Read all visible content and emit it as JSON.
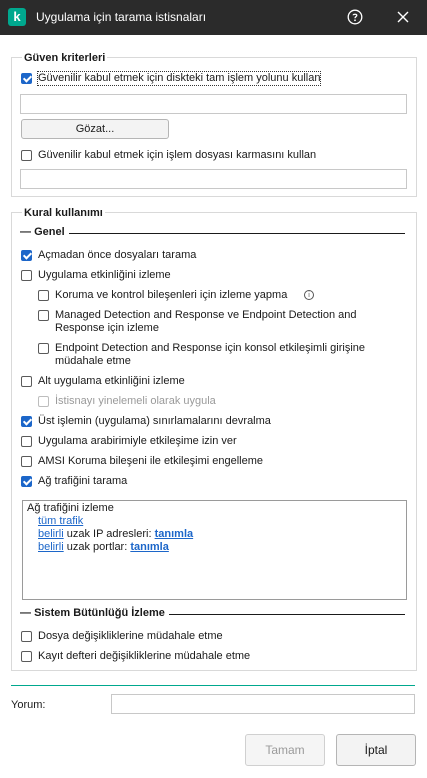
{
  "window": {
    "logo_letter": "k",
    "title": "Uygulama için tarama istisnaları"
  },
  "trust": {
    "title": "Güven kriterleri",
    "cb1_label": "Güvenilir kabul etmek için diskteki tam işlem yolunu kullan",
    "cb1_checked": true,
    "path_value": "",
    "browse_label": "Gözat...",
    "cb2_label": "Güvenilir kabul etmek için işlem dosyası karmasını kullan",
    "cb2_checked": false,
    "hash_value": ""
  },
  "rules": {
    "title": "Kural kullanımı",
    "general_heading": "Genel",
    "items": [
      {
        "label": "Açmadan önce dosyaları tarama",
        "checked": true
      },
      {
        "label": "Uygulama etkinliğini izleme",
        "checked": false
      },
      {
        "label": "Koruma ve kontrol bileşenleri için izleme yapma",
        "checked": false
      },
      {
        "label": "Managed Detection and Response ve Endpoint Detection and Response için izleme",
        "checked": false
      },
      {
        "label": "Endpoint Detection and Response için konsol etkileşimli girişine müdahale etme",
        "checked": false
      },
      {
        "label": "Alt uygulama etkinliğini izleme",
        "checked": false
      },
      {
        "label": "İstisnayı yinelemeli olarak uygula",
        "checked": false,
        "disabled": true
      },
      {
        "label": "Üst işlemin (uygulama) sınırlamalarını devralma",
        "checked": true
      },
      {
        "label": "Uygulama arabirimiyle etkileşime izin ver",
        "checked": false
      },
      {
        "label": "AMSI Koruma bileşeni ile etkileşimi engelleme",
        "checked": false
      },
      {
        "label": "Ağ trafiğini tarama",
        "checked": true
      }
    ],
    "traffic": {
      "heading": "Ağ trafiğini izleme",
      "all_traffic": "tüm trafik",
      "specified": "belirli",
      "remote_ip_text": "uzak IP adresleri:",
      "define": "tanımla",
      "remote_ports_text": "uzak portlar:"
    },
    "integrity_heading": "Sistem Bütünlüğü İzleme",
    "integrity_items": [
      {
        "label": "Dosya değişikliklerine müdahale etme",
        "checked": false
      },
      {
        "label": "Kayıt defteri değişikliklerine müdahale etme",
        "checked": false
      }
    ]
  },
  "comment": {
    "label": "Yorum:",
    "value": ""
  },
  "footer": {
    "ok_label": "Tamam",
    "cancel_label": "İptal"
  },
  "colors": {
    "accent": "#1c66c9",
    "brand": "#00a88e",
    "titlebar": "#2b2b2b"
  }
}
